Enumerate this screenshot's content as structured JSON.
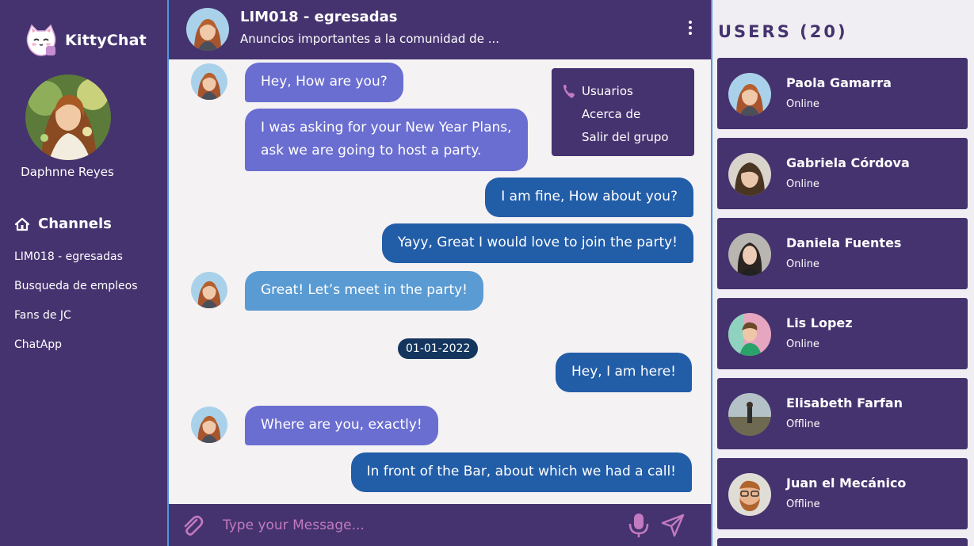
{
  "app": {
    "name": "KittyChat"
  },
  "profile": {
    "name": "Daphnne Reyes"
  },
  "channels": {
    "title": "Channels",
    "items": [
      {
        "label": "LIM018 - egresadas"
      },
      {
        "label": "Busqueda de empleos"
      },
      {
        "label": "Fans de JC"
      },
      {
        "label": "ChatApp"
      }
    ]
  },
  "chat": {
    "title": "LIM018 - egresadas",
    "subtitle": "Anuncios importantes a la comunidad de  ...",
    "date_divider": "01-01-2022",
    "messages": [
      {
        "text": "Hey, How are you?"
      },
      {
        "text_line1": "I was asking for your New Year Plans,",
        "text_line2": "ask we are going to host a party."
      },
      {
        "text": "I am fine, How about you?"
      },
      {
        "text": "Yayy, Great I would love to join the party!"
      },
      {
        "text": "Great! Let’s meet in the party!"
      },
      {
        "text": "Hey, I am here!"
      },
      {
        "text": "Where are you, exactly!"
      },
      {
        "text": "In front of the Bar, about which we had a call!"
      }
    ],
    "menu": {
      "items": [
        {
          "label": "Usuarios"
        },
        {
          "label": "Acerca de"
        },
        {
          "label": "Salir del grupo"
        }
      ]
    },
    "composer": {
      "placeholder": "Type your Message..."
    }
  },
  "users": {
    "title": "USERS (20)",
    "items": [
      {
        "name": "Paola Gamarra",
        "status": "Online"
      },
      {
        "name": "Gabriela Córdova",
        "status": "Online"
      },
      {
        "name": "Daniela Fuentes",
        "status": "Online"
      },
      {
        "name": "Lis Lopez",
        "status": "Online"
      },
      {
        "name": "Elisabeth Farfan",
        "status": "Offline"
      },
      {
        "name": "Juan el Mecánico",
        "status": "Offline"
      }
    ]
  },
  "colors": {
    "panel": "#45336f",
    "incoming": "#6a6ed0",
    "outgoing": "#225da8",
    "accent_pink": "#c27ac0",
    "border_blue": "#4e97e0"
  }
}
